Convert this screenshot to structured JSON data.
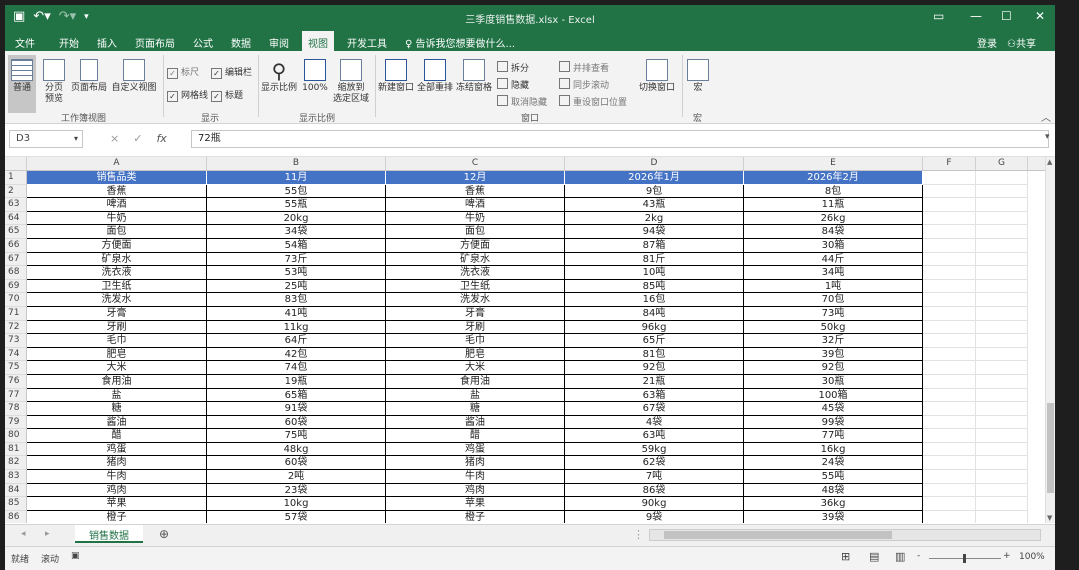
{
  "window": {
    "title": "三季度销售数据.xlsx - Excel",
    "save_icon": "save-icon",
    "undo_icon": "undo-icon",
    "redo_icon": "redo-icon"
  },
  "tabs": [
    "文件",
    "开始",
    "插入",
    "页面布局",
    "公式",
    "数据",
    "审阅",
    "视图",
    "开发工具"
  ],
  "active_tab": "视图",
  "tell_me": "告诉我您想要做什么...",
  "login": "登录",
  "share": "共享",
  "ribbon": {
    "workbook_views": {
      "label": "工作簿视图",
      "normal": "普通",
      "page_break_l1": "分页",
      "page_break_l2": "预览",
      "page_layout": "页面布局",
      "custom_views": "自定义视图"
    },
    "show": {
      "label": "显示",
      "ruler": "标尺",
      "formula_bar": "编辑栏",
      "gridlines": "网格线",
      "headings": "标题"
    },
    "zoom": {
      "label": "显示比例",
      "zoom": "显示比例",
      "zoom100": "100%",
      "zoom_sel_l1": "缩放到",
      "zoom_sel_l2": "选定区域"
    },
    "window": {
      "label": "窗口",
      "new_window": "新建窗口",
      "arrange_all": "全部重排",
      "freeze": "冻结窗格",
      "split": "拆分",
      "hide": "隐藏",
      "unhide": "取消隐藏",
      "side_by_side": "并排查看",
      "sync_scroll": "同步滚动",
      "reset_pos": "重设窗口位置",
      "switch_windows": "切换窗口"
    },
    "macros": {
      "label": "宏",
      "button": "宏"
    }
  },
  "formula_bar": {
    "name_box": "D3",
    "cancel": "×",
    "enter": "✓",
    "fx": "fx",
    "content": "72瓶"
  },
  "columns": [
    "A",
    "B",
    "C",
    "D",
    "E",
    "F",
    "G"
  ],
  "header_row": {
    "num": "1",
    "cells": [
      "销售品类",
      "11月",
      "12月",
      "2026年1月",
      "2026年2月"
    ]
  },
  "rows": [
    {
      "num": "2",
      "cells": [
        "香蕉",
        "55包",
        "香蕉",
        "9包",
        "8包"
      ]
    },
    {
      "num": "63",
      "cells": [
        "啤酒",
        "55瓶",
        "啤酒",
        "43瓶",
        "11瓶"
      ]
    },
    {
      "num": "64",
      "cells": [
        "牛奶",
        "20kg",
        "牛奶",
        "2kg",
        "26kg"
      ]
    },
    {
      "num": "65",
      "cells": [
        "面包",
        "34袋",
        "面包",
        "94袋",
        "84袋"
      ]
    },
    {
      "num": "66",
      "cells": [
        "方便面",
        "54箱",
        "方便面",
        "87箱",
        "30箱"
      ]
    },
    {
      "num": "67",
      "cells": [
        "矿泉水",
        "73斤",
        "矿泉水",
        "81斤",
        "44斤"
      ]
    },
    {
      "num": "68",
      "cells": [
        "洗衣液",
        "53吨",
        "洗衣液",
        "10吨",
        "34吨"
      ]
    },
    {
      "num": "69",
      "cells": [
        "卫生纸",
        "25吨",
        "卫生纸",
        "85吨",
        "1吨"
      ]
    },
    {
      "num": "70",
      "cells": [
        "洗发水",
        "83包",
        "洗发水",
        "16包",
        "70包"
      ]
    },
    {
      "num": "71",
      "cells": [
        "牙膏",
        "41吨",
        "牙膏",
        "84吨",
        "73吨"
      ]
    },
    {
      "num": "72",
      "cells": [
        "牙刷",
        "11kg",
        "牙刷",
        "96kg",
        "50kg"
      ]
    },
    {
      "num": "73",
      "cells": [
        "毛巾",
        "64斤",
        "毛巾",
        "65斤",
        "32斤"
      ]
    },
    {
      "num": "74",
      "cells": [
        "肥皂",
        "42包",
        "肥皂",
        "81包",
        "39包"
      ]
    },
    {
      "num": "75",
      "cells": [
        "大米",
        "74包",
        "大米",
        "92包",
        "92包"
      ]
    },
    {
      "num": "76",
      "cells": [
        "食用油",
        "19瓶",
        "食用油",
        "21瓶",
        "30瓶"
      ]
    },
    {
      "num": "77",
      "cells": [
        "盐",
        "65箱",
        "盐",
        "63箱",
        "100箱"
      ]
    },
    {
      "num": "78",
      "cells": [
        "糖",
        "91袋",
        "糖",
        "67袋",
        "45袋"
      ]
    },
    {
      "num": "79",
      "cells": [
        "酱油",
        "60袋",
        "酱油",
        "4袋",
        "99袋"
      ]
    },
    {
      "num": "80",
      "cells": [
        "醋",
        "75吨",
        "醋",
        "63吨",
        "77吨"
      ]
    },
    {
      "num": "81",
      "cells": [
        "鸡蛋",
        "48kg",
        "鸡蛋",
        "59kg",
        "16kg"
      ]
    },
    {
      "num": "82",
      "cells": [
        "猪肉",
        "60袋",
        "猪肉",
        "62袋",
        "24袋"
      ]
    },
    {
      "num": "83",
      "cells": [
        "牛肉",
        "2吨",
        "牛肉",
        "7吨",
        "55吨"
      ]
    },
    {
      "num": "84",
      "cells": [
        "鸡肉",
        "23袋",
        "鸡肉",
        "86袋",
        "48袋"
      ]
    },
    {
      "num": "85",
      "cells": [
        "苹果",
        "10kg",
        "苹果",
        "90kg",
        "36kg"
      ]
    },
    {
      "num": "86",
      "cells": [
        "橙子",
        "57袋",
        "橙子",
        "9袋",
        "39袋"
      ]
    }
  ],
  "sheet_tab": "销售数据",
  "status": {
    "ready": "就绪",
    "scroll": "滚动",
    "zoom": "100%"
  }
}
